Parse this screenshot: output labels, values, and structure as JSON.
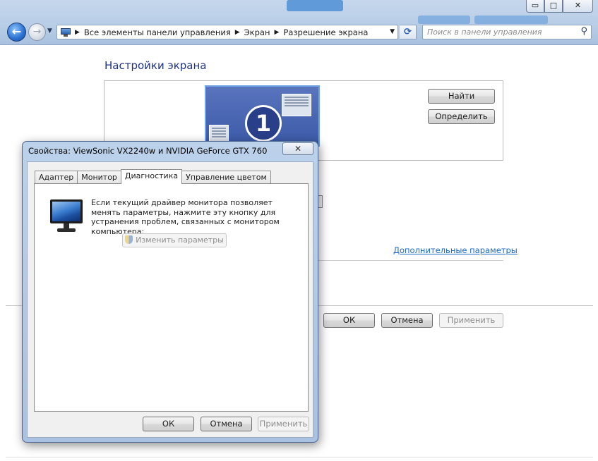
{
  "window": {
    "controls": {
      "minimize": "▭",
      "maximize": "□",
      "close": "✕"
    }
  },
  "nav": {
    "back": "←",
    "forward": "→"
  },
  "breadcrumbs": [
    "Все элементы панели управления",
    "Экран",
    "Разрешение экрана"
  ],
  "search": {
    "placeholder": "Поиск в панели управления"
  },
  "settings": {
    "title": "Настройки экрана",
    "monitor_number": "1",
    "find_button": "Найти",
    "identify_button": "Определить",
    "advanced_link": "Дополнительные параметры",
    "ok": "ОК",
    "cancel": "Отмена",
    "apply": "Применить"
  },
  "dialog": {
    "title": "Свойства: ViewSonic VX2240w и NVIDIA GeForce GTX 760",
    "close": "✕",
    "tabs": [
      {
        "label": "Адаптер",
        "active": false
      },
      {
        "label": "Монитор",
        "active": false
      },
      {
        "label": "Диагностика",
        "active": true
      },
      {
        "label": "Управление цветом",
        "active": false
      }
    ],
    "diagnostics_text": "Если текущий драйвер монитора позволяет менять параметры, нажмите эту кнопку для устранения проблем, связанных с монитором компьютера:",
    "change_params_button": "Изменить параметры",
    "ok": "ОК",
    "cancel": "Отмена",
    "apply": "Применить"
  }
}
